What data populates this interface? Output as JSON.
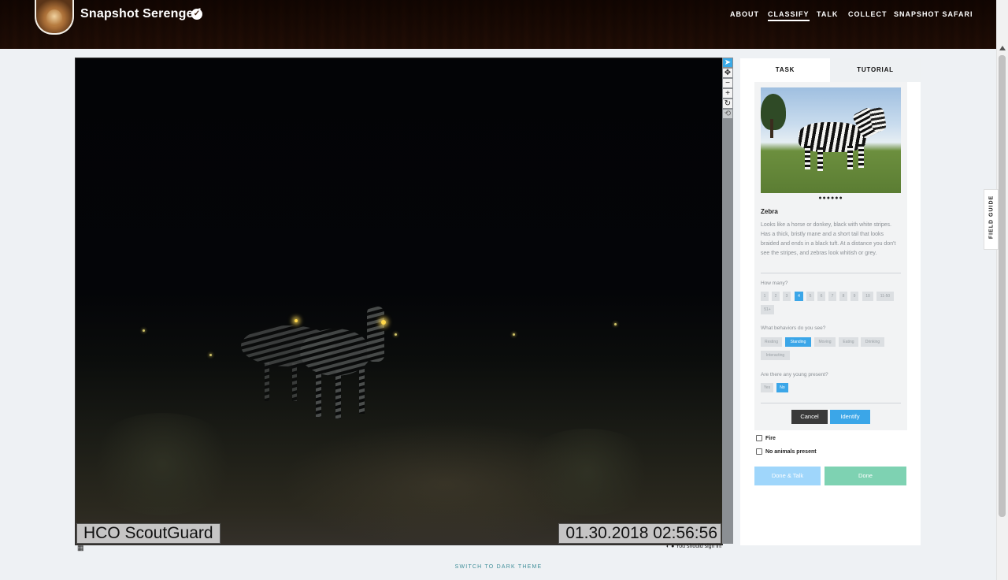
{
  "header": {
    "title": "Snapshot Serengeti",
    "nav": [
      "ABOUT",
      "CLASSIFY",
      "TALK",
      "COLLECT",
      "SNAPSHOT SAFARI"
    ],
    "active_nav": "CLASSIFY"
  },
  "viewer": {
    "camera_label": "HCO ScoutGuard",
    "timestamp": "01.30.2018 02:56:56",
    "tools": [
      "pointer-icon",
      "pan-icon",
      "zoom-out-icon",
      "zoom-in-icon",
      "rotate-icon",
      "reset-icon"
    ],
    "signin_note": "You should sign in!"
  },
  "panel": {
    "tabs": [
      "TASK",
      "TUTORIAL"
    ],
    "active_tab": "TASK",
    "carousel_dots": "●●●●●●",
    "species_name": "Zebra",
    "species_description": "Looks like a horse or donkey, black with white stripes. Has a thick, bristly mane and a short tail that looks braided and ends in a black tuft. At a distance you don't see the stripes, and zebras look whitish or grey.",
    "how_many": {
      "question": "How many?",
      "options": [
        "1",
        "2",
        "3",
        "4",
        "5",
        "6",
        "7",
        "8",
        "9",
        "10",
        "11-50",
        "51+"
      ],
      "selected": "4"
    },
    "behaviors": {
      "question": "What behaviors do you see?",
      "options": [
        "Resting",
        "Standing",
        "Moving",
        "Eating",
        "Drinking",
        "Interacting"
      ],
      "selected": [
        "Standing"
      ]
    },
    "young": {
      "question": "Are there any young present?",
      "options": [
        "Yes",
        "No"
      ],
      "selected": "No"
    },
    "cancel_label": "Cancel",
    "identify_label": "Identify",
    "checkbox_fire": "Fire",
    "checkbox_no_animals": "No animals present",
    "done_talk_label": "Done & Talk",
    "done_label": "Done"
  },
  "field_guide_label": "FIELD GUIDE",
  "footer": {
    "theme_switch": "SWITCH TO DARK THEME"
  },
  "colors": {
    "accent": "#3ba6e8",
    "done": "#7ed2b2",
    "done_talk": "#9fd6fb",
    "header": "#3a1e10"
  }
}
